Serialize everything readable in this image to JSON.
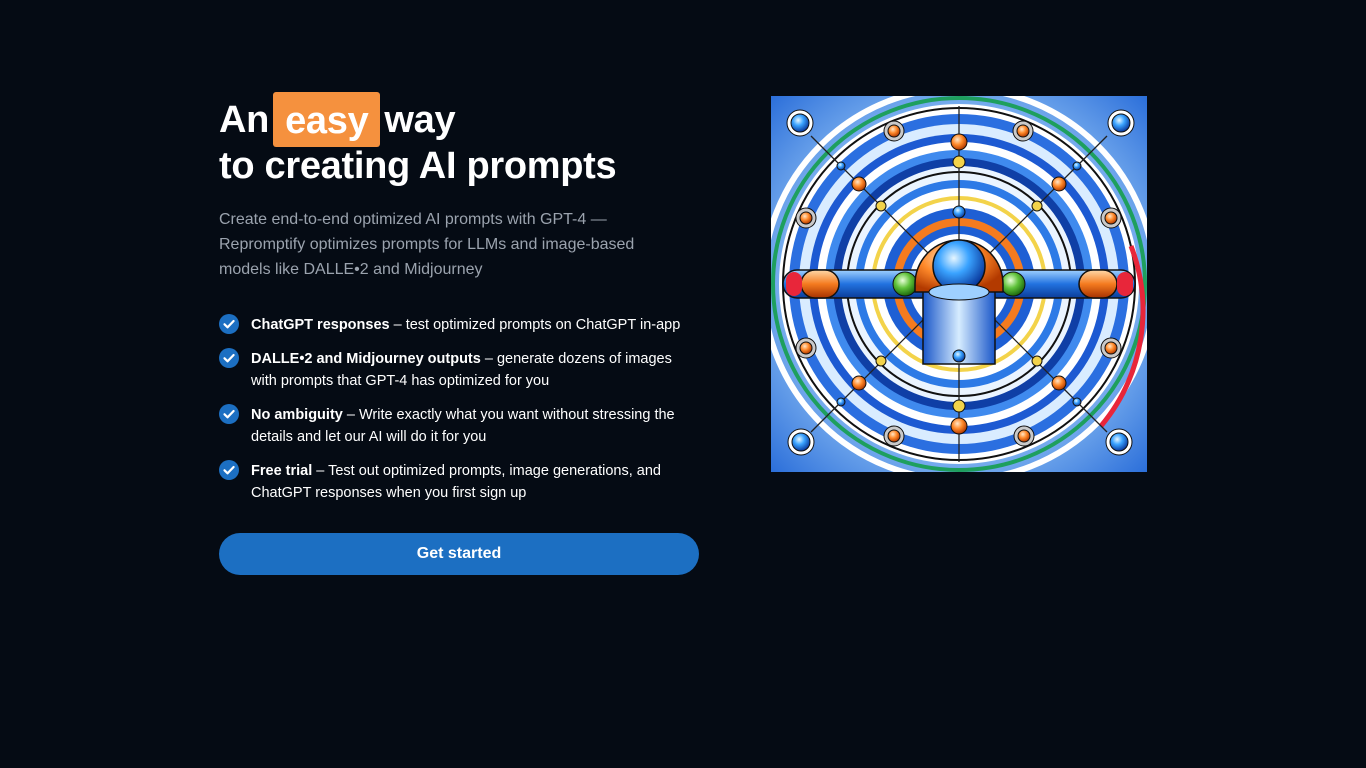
{
  "hero": {
    "headline_prefix": "An",
    "headline_highlight": "easy",
    "headline_suffix": "way",
    "headline_line2": "to creating AI prompts",
    "subtitle": "Create end-to-end optimized AI prompts with GPT-4 — Repromptify optimizes prompts for LLMs and image-based models like DALLE•2 and Midjourney",
    "features": [
      {
        "title": "ChatGPT responses",
        "text": " – test optimized prompts on ChatGPT in-app",
        "icon": "check-circle-icon"
      },
      {
        "title": "DALLE•2 and Midjourney outputs",
        "text": " – generate dozens of images with prompts that GPT-4 has optimized for you",
        "icon": "check-circle-icon"
      },
      {
        "title": "No ambiguity",
        "text": " – Write exactly what you want without stressing the details and let our AI will do it for you",
        "icon": "check-circle-icon"
      },
      {
        "title": "Free trial",
        "text": " – Test out optimized prompts, image generations, and ChatGPT responses when you first sign up",
        "icon": "check-circle-icon"
      }
    ],
    "cta_label": "Get started"
  },
  "colors": {
    "background": "#050b14",
    "highlight": "#f5913e",
    "accent": "#1c6fc2",
    "muted_text": "#9ba3ae"
  }
}
